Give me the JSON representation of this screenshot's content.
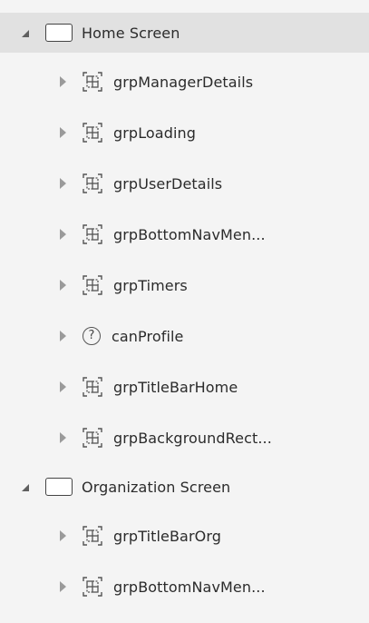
{
  "tree": {
    "screens": [
      {
        "label": "Home Screen",
        "children": [
          {
            "label": "grpManagerDetails"
          },
          {
            "label": "grpLoading"
          },
          {
            "label": "grpUserDetails"
          },
          {
            "label": "grpBottomNavMen..."
          },
          {
            "label": "grpTimers"
          },
          {
            "label": "canProfile"
          },
          {
            "label": "grpTitleBarHome"
          },
          {
            "label": "grpBackgroundRect..."
          }
        ]
      },
      {
        "label": "Organization Screen",
        "children": [
          {
            "label": "grpTitleBarOrg"
          },
          {
            "label": "grpBottomNavMen..."
          }
        ]
      }
    ],
    "help_glyph": "?"
  },
  "colors": {
    "selected_bg": "#e1e1e1",
    "panel_bg": "#f4f4f4",
    "text": "#2b2b2b"
  }
}
